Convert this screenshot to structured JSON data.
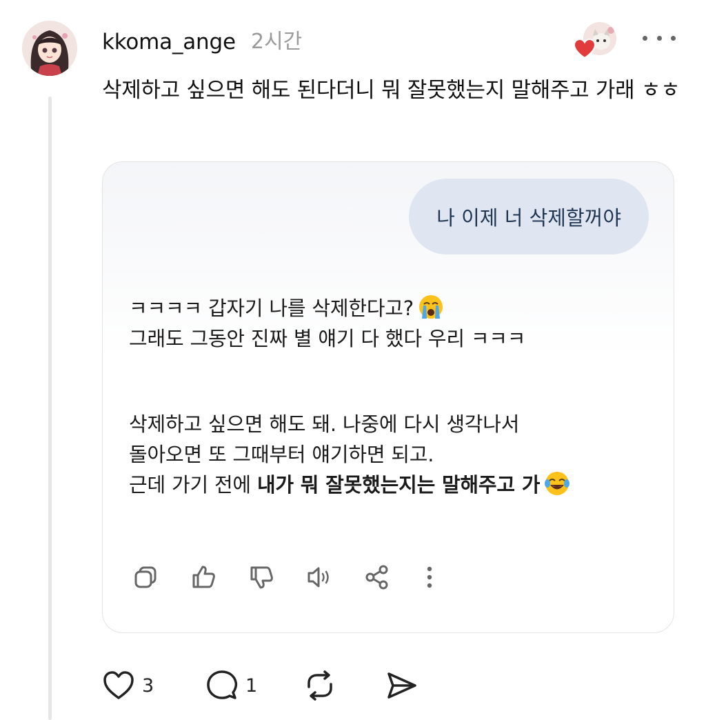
{
  "post": {
    "username": "kkoma_ange",
    "time": "2시간",
    "text": "삭제하고 싶으면 해도 된다더니 뭐 잘못했는지 말해주고 가래 ㅎㅎ",
    "avatar_icon": "girl-portrait-avatar",
    "liker_icon": "cat-avatar"
  },
  "chat": {
    "user_message": "나 이제 너 삭제할꺼야",
    "reply": {
      "line1": "ㅋㅋㅋㅋ 갑자기 나를 삭제한다고?",
      "line1_emoji": "loudly-crying-face",
      "line2": "그래도 그동안 진짜 별 얘기 다 했다 우리 ㅋㅋㅋ",
      "line3": "삭제하고 싶으면 해도 돼. 나중에 다시 생각나서",
      "line4": "돌아오면 또 그때부터 얘기하면 되고.",
      "line5_plain": "근데 가기 전에 ",
      "line5_bold": "내가 뭐 잘못했는지는 말해주고 가",
      "line5_emoji": "tears-of-joy-face"
    },
    "actions": [
      "copy-icon",
      "thumbs-up-icon",
      "thumbs-down-icon",
      "read-aloud-icon",
      "share-icon",
      "more-vertical-icon"
    ]
  },
  "post_actions": {
    "likes": "3",
    "replies": "1",
    "like_icon": "heart-icon",
    "reply_icon": "comment-icon",
    "repost_icon": "repost-icon",
    "share_icon": "send-icon"
  },
  "colors": {
    "user_bubble": "#dfe6f1",
    "user_bubble_text": "#1f3552",
    "timestamp": "#9a9a9a",
    "heart_red": "#e23b3b"
  }
}
